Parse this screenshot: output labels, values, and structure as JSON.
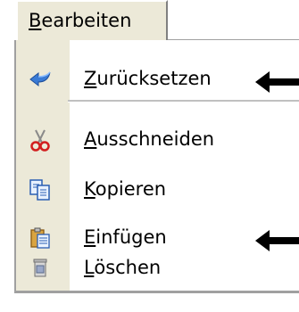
{
  "menu": {
    "title_underlined": "B",
    "title_rest": "earbeiten",
    "items": [
      {
        "underlined": "Z",
        "rest": "urücksetzen",
        "icon": "undo-arrow-icon"
      },
      {
        "underlined": "A",
        "rest": "usschneiden",
        "icon": "scissors-icon"
      },
      {
        "underlined": "K",
        "rest": "opieren",
        "icon": "copy-icon"
      },
      {
        "underlined": "E",
        "rest": "infügen",
        "icon": "paste-clipboard-icon"
      },
      {
        "underlined": "L",
        "rest": "öschen",
        "icon": "delete-bin-icon"
      }
    ]
  },
  "annotations": {
    "arrow_color": "#000000",
    "arrows_point_to": [
      "Zurücksetzen",
      "Einfügen"
    ]
  }
}
